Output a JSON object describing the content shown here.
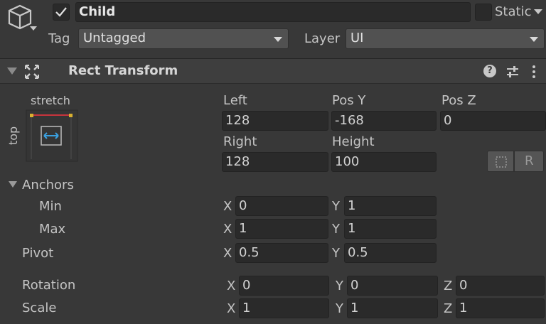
{
  "object": {
    "name": "Child",
    "active_checked": true,
    "static_label": "Static",
    "tag_label": "Tag",
    "tag_value": "Untagged",
    "layer_label": "Layer",
    "layer_value": "UI"
  },
  "component": {
    "title": "Rect Transform"
  },
  "anchor_preset": {
    "horizontal": "stretch",
    "vertical": "top"
  },
  "rect": {
    "left_label": "Left",
    "left_value": "128",
    "posy_label": "Pos Y",
    "posy_value": "-168",
    "posz_label": "Pos Z",
    "posz_value": "0",
    "right_label": "Right",
    "right_value": "128",
    "height_label": "Height",
    "height_value": "100",
    "raw_button_label": "R"
  },
  "anchors": {
    "label": "Anchors",
    "min_label": "Min",
    "min_x": "0",
    "min_y": "1",
    "max_label": "Max",
    "max_x": "1",
    "max_y": "1"
  },
  "pivot": {
    "label": "Pivot",
    "x": "0.5",
    "y": "0.5"
  },
  "rotation": {
    "label": "Rotation",
    "x": "0",
    "y": "0",
    "z": "0"
  },
  "scale": {
    "label": "Scale",
    "x": "1",
    "y": "1",
    "z": "1"
  },
  "axes": {
    "x": "X",
    "y": "Y",
    "z": "Z"
  },
  "colors": {
    "background": "#383838",
    "field": "#2a2a2a",
    "header": "#3e3e3e",
    "anchor_red": "#c8343c",
    "anchor_yellow": "#d8b030",
    "arrow_blue": "#3aa0e0"
  }
}
